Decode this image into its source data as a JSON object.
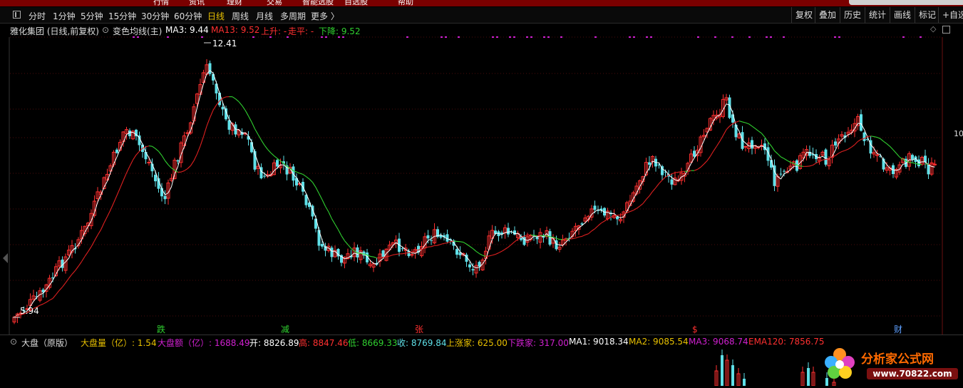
{
  "top_strip": {
    "menu": [
      "行情",
      "资讯",
      "理财",
      "交易",
      "智能选股",
      "自选股",
      "帮助"
    ]
  },
  "toolbar": {
    "periods": [
      "分时",
      "1分钟",
      "5分钟",
      "15分钟",
      "30分钟",
      "60分钟",
      "日线",
      "周线",
      "月线",
      "多周期",
      "更多 〉"
    ],
    "active_period": "日线",
    "right_buttons": [
      "复权",
      "叠加",
      "历史",
      "统计",
      "画线",
      "标记",
      "+自选"
    ]
  },
  "info": {
    "stock": "雅化集团 (日线,前复权)",
    "indicator": "变色均线(主)",
    "ma3": "MA3: 9.44",
    "ma13": "MA13: 9.52",
    "up": "上升: -",
    "flat": "走平: -",
    "down": "下降: 9.52"
  },
  "price": {
    "high_label": "12.41",
    "low_label": "5.94",
    "right_tick": "10"
  },
  "markers": [
    "跌",
    "减",
    "张",
    "$",
    "财"
  ],
  "colors": {
    "bull": "#ff3030",
    "bear": "#5fe0e8",
    "ma3": "#ffffff",
    "ma13_up": "#e02020",
    "ma13_down": "#30d030",
    "dots": "#d020d0"
  },
  "indicator": {
    "name": "大盘（原版）",
    "vol": "大盘量（亿）: 1.54",
    "amt": "大盘额（亿）: 1688.49",
    "open": "开: 8826.89",
    "high": "高: 8847.46",
    "low": "低: 8669.33",
    "close": "收: 8769.84",
    "up": "上涨家: 625.00",
    "down": "下跌家: 317.00",
    "ma1": "MA1: 9018.34",
    "ma2": "MA2: 9085.54",
    "ma3": "MA3: 9068.74",
    "ema120": "EMA120: 7856.75"
  },
  "watermark": {
    "title": "分析家公式网",
    "url": "www.70822.com"
  }
}
